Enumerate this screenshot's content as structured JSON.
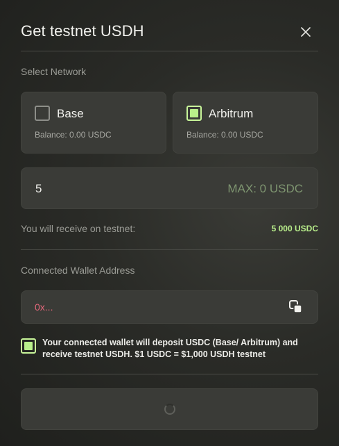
{
  "modal": {
    "title": "Get testnet USDH"
  },
  "network": {
    "section_label": "Select Network",
    "options": [
      {
        "name": "Base",
        "balance": "Balance: 0.00 USDC",
        "selected": false
      },
      {
        "name": "Arbitrum",
        "balance": "Balance: 0.00 USDC",
        "selected": true
      }
    ]
  },
  "amount": {
    "value": "5",
    "max_label": "MAX: 0 USDC"
  },
  "receive": {
    "label": "You will receive on testnet:",
    "value": "5 000 USDC"
  },
  "wallet": {
    "section_label": "Connected Wallet Address",
    "address": "0x..."
  },
  "consent": {
    "checked": true,
    "text": "Your connected wallet will deposit USDC (Base/ Arbitrum) and receive testnet USDH. $1 USDC = $1,000 USDH testnet"
  },
  "submit": {
    "state": "loading"
  },
  "colors": {
    "accent": "#b9ef8a",
    "address": "#e3677a",
    "card_bg": "#3a3b37"
  },
  "icons": {
    "close": "close-icon",
    "copy": "copy-icon",
    "spinner": "loading-spinner-icon"
  }
}
